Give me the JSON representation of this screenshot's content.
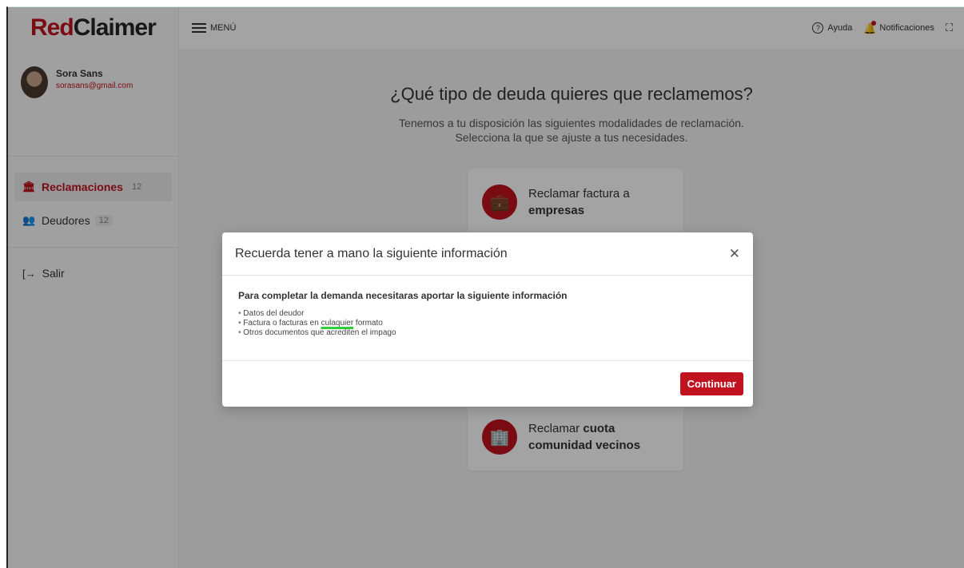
{
  "app": {
    "logo_red": "Red",
    "logo_dark": "Claimer",
    "brand_color": "#c0121f"
  },
  "user": {
    "name": "Sora Sans",
    "email": "sorasans@gmail.com"
  },
  "sidebar": {
    "items": [
      {
        "label": "Reclamaciones",
        "count": "12",
        "active": true,
        "icon": "bank-icon"
      },
      {
        "label": "Deudores",
        "count": "12",
        "active": false,
        "icon": "users-icon"
      }
    ],
    "logout_label": "Salir"
  },
  "topbar": {
    "menu_label": "MENÚ",
    "help_label": "Ayuda",
    "notifications_label": "Notificaciones"
  },
  "main": {
    "title": "¿Qué tipo de deuda quieres que reclamemos?",
    "subtitle_line1": "Tenemos a tu disposición las siguientes modalidades de reclamación.",
    "subtitle_line2": "Selecciona la que se ajuste a tus necesidades.",
    "cards": [
      {
        "line1": "Reclamar factura a",
        "bold": "empresas",
        "icon": "briefcase-icon"
      },
      {
        "line1_plain": "Reclamar ",
        "line1_bold": "cuota",
        "line2_bold": "comunidad vecinos",
        "icon": "building-icon"
      }
    ]
  },
  "modal": {
    "title": "Recuerda tener a mano la siguiente información",
    "lead": "Para completar la demanda necesitaras aportar la siguiente información",
    "items": [
      "Datos del deudor",
      "Factura o facturas en culaquier formato",
      "Otros documentos que acrediten el impago"
    ],
    "item2_before": "Factura o facturas en ",
    "item2_typo": "culaquier",
    "item2_after": " formato",
    "continue_label": "Continuar"
  }
}
